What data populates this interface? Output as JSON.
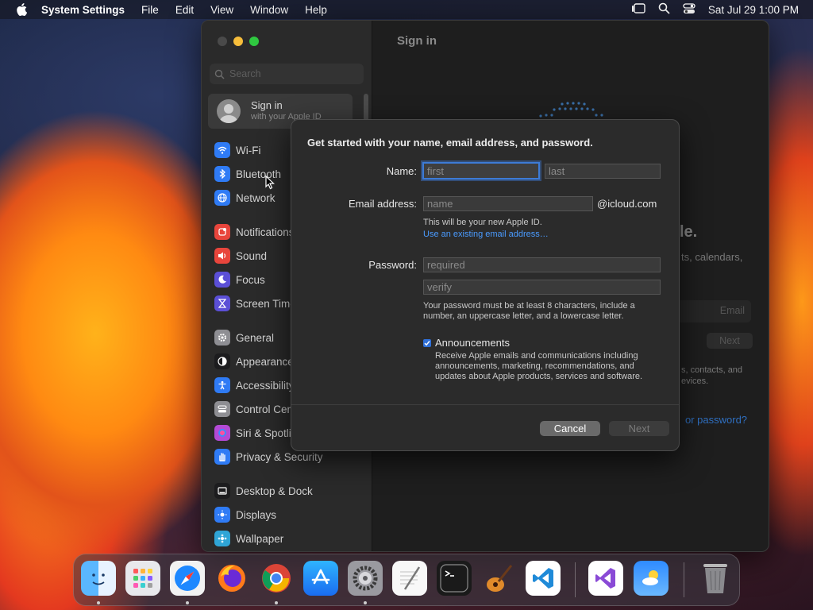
{
  "menubar": {
    "app_name": "System Settings",
    "menus": [
      "File",
      "Edit",
      "View",
      "Window",
      "Help"
    ],
    "clock": "Sat Jul 29  1:00 PM"
  },
  "window": {
    "content_title": "Sign in",
    "search_placeholder": "Search",
    "account": {
      "title": "Sign in",
      "subtitle": "with your Apple ID"
    },
    "sidebar": [
      {
        "label": "Wi-Fi",
        "icon": "wifi-icon",
        "color": "#2f7bf5"
      },
      {
        "label": "Bluetooth",
        "icon": "bluetooth-icon",
        "color": "#2f7bf5"
      },
      {
        "label": "Network",
        "icon": "globe-icon",
        "color": "#2f7bf5"
      },
      {
        "label": "Notifications",
        "icon": "bell-icon",
        "color": "#e8453c"
      },
      {
        "label": "Sound",
        "icon": "speaker-icon",
        "color": "#e8453c"
      },
      {
        "label": "Focus",
        "icon": "moon-icon",
        "color": "#5b4fd6"
      },
      {
        "label": "Screen Time",
        "icon": "hourglass-icon",
        "color": "#5b4fd6"
      },
      {
        "label": "General",
        "icon": "gear-icon",
        "color": "#8e8e93"
      },
      {
        "label": "Appearance",
        "icon": "appearance-icon",
        "color": "#1c1c1e"
      },
      {
        "label": "Accessibility",
        "icon": "accessibility-icon",
        "color": "#2f7bf5"
      },
      {
        "label": "Control Center",
        "icon": "control-center-icon",
        "color": "#8e8e93"
      },
      {
        "label": "Siri & Spotlight",
        "icon": "siri-icon",
        "color": "#b34ad6"
      },
      {
        "label": "Privacy & Security",
        "icon": "hand-icon",
        "color": "#2f7bf5"
      },
      {
        "label": "Desktop & Dock",
        "icon": "dock-icon",
        "color": "#1c1c1e"
      },
      {
        "label": "Displays",
        "icon": "sun-icon",
        "color": "#2f7bf5"
      },
      {
        "label": "Wallpaper",
        "icon": "wallpaper-icon",
        "color": "#2fa5d6"
      }
    ],
    "background": {
      "headline_tail": "le.",
      "line1": "ts, calendars,",
      "email_placeholder": "Email",
      "next_label": "Next",
      "line2": "s, contacts, and",
      "line3": "evices.",
      "forgot_link": "or password?"
    }
  },
  "dialog": {
    "heading": "Get started with your name, email address, and password.",
    "name_label": "Name:",
    "first_placeholder": "first",
    "last_placeholder": "last",
    "email_label": "Email address:",
    "email_placeholder": "name",
    "email_domain": "@icloud.com",
    "email_help": "This will be your new Apple ID.",
    "existing_email_link": "Use an existing email address…",
    "password_label": "Password:",
    "password_placeholder": "required",
    "verify_placeholder": "verify",
    "password_help_line1": "Your password must be at least 8 characters, include a",
    "password_help_line2": "number, an uppercase letter, and a lowercase letter.",
    "announcements_label": "Announcements",
    "announcements_checked": true,
    "announcements_line1": "Receive Apple emails and communications including",
    "announcements_line2": "announcements, marketing, recommendations, and",
    "announcements_line3": "updates about Apple products, services and software.",
    "cancel_label": "Cancel",
    "next_label": "Next"
  },
  "dock": [
    {
      "name": "finder-icon",
      "running": true
    },
    {
      "name": "launchpad-icon",
      "running": false
    },
    {
      "name": "safari-icon",
      "running": true
    },
    {
      "name": "firefox-icon",
      "running": false
    },
    {
      "name": "chrome-icon",
      "running": true
    },
    {
      "name": "app-store-icon",
      "running": false
    },
    {
      "name": "system-settings-icon",
      "running": true
    },
    {
      "name": "textedit-icon",
      "running": false
    },
    {
      "name": "terminal-icon",
      "running": false
    },
    {
      "name": "garageband-icon",
      "running": false
    },
    {
      "name": "vscode-icon",
      "running": false
    },
    {
      "name": "visual-studio-icon",
      "running": false
    },
    {
      "name": "weather-icon",
      "running": false
    },
    {
      "name": "trash-icon",
      "running": false
    }
  ]
}
